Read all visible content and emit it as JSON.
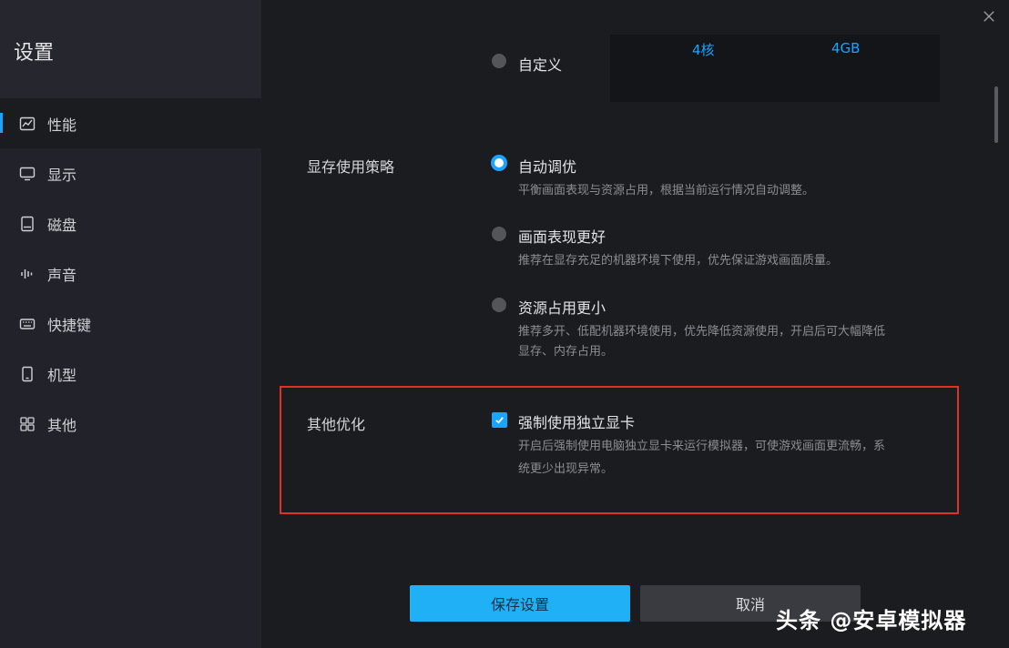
{
  "sidebar": {
    "title": "设置",
    "items": [
      {
        "label": "性能",
        "icon": "chart-icon"
      },
      {
        "label": "显示",
        "icon": "monitor-icon"
      },
      {
        "label": "磁盘",
        "icon": "disk-icon"
      },
      {
        "label": "声音",
        "icon": "sound-icon"
      },
      {
        "label": "快捷键",
        "icon": "keyboard-icon"
      },
      {
        "label": "机型",
        "icon": "phone-icon"
      },
      {
        "label": "其他",
        "icon": "grid-icon"
      }
    ]
  },
  "custom_option": {
    "label": "自定义",
    "cores": "4核",
    "memory": "4GB"
  },
  "vram": {
    "label": "显存使用策略",
    "options": [
      {
        "label": "自动调优",
        "desc": "平衡画面表现与资源占用，根据当前运行情况自动调整。",
        "selected": true
      },
      {
        "label": "画面表现更好",
        "desc": "推荐在显存充足的机器环境下使用，优先保证游戏画面质量。",
        "selected": false
      },
      {
        "label": "资源占用更小",
        "desc_line1": "推荐多开、低配机器环境使用，优先降低资源使用，开启后可大幅降低",
        "desc_line2": "显存、内存占用。",
        "selected": false
      }
    ]
  },
  "other": {
    "label": "其他优化",
    "checkbox_label": "强制使用独立显卡",
    "checked": true,
    "desc_line1": "开启后强制使用电脑独立显卡来运行模拟器，可使游戏画面更流畅，系",
    "desc_line2": "统更少出现异常。"
  },
  "buttons": {
    "save": "保存设置",
    "cancel": "取消"
  },
  "watermark": "头条 @安卓模拟器",
  "colors": {
    "accent": "#1aa3ff",
    "highlight": "#e0302a",
    "background": "#1b1c20"
  }
}
